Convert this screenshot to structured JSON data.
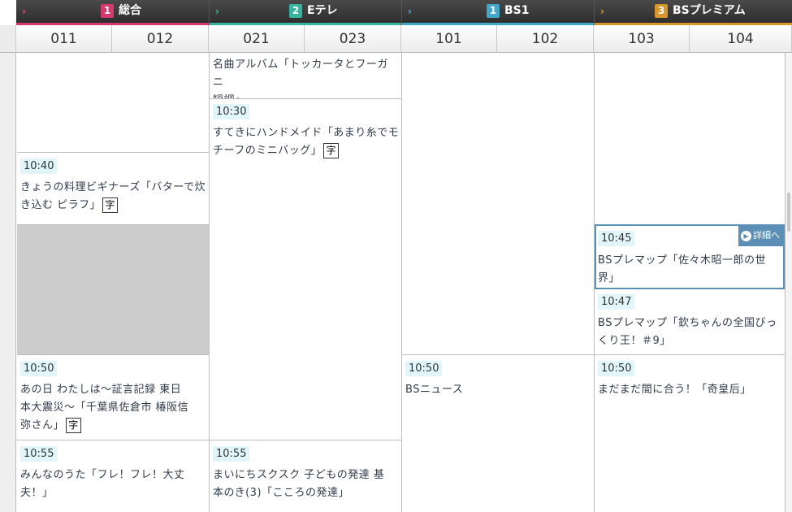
{
  "channels": [
    {
      "marker": "›",
      "marker_color": "#e84a8a",
      "num": "1",
      "num_color": "#d6386f",
      "name": "総合",
      "bar_color": "#d6386f"
    },
    {
      "marker": "›",
      "marker_color": "#3ec2a8",
      "num": "2",
      "num_color": "#35b59e",
      "name": "Eテレ",
      "bar_color": "#35b59e"
    },
    {
      "marker": "›",
      "marker_color": "#4ab4d4",
      "num": "1",
      "num_color": "#40a9c9",
      "name": "BS1",
      "bar_color": "#40a9c9"
    },
    {
      "marker": "›",
      "marker_color": "#e1a22a",
      "num": "3",
      "num_color": "#d9962a",
      "name": "BSプレミアム",
      "bar_color": "#d9962a"
    }
  ],
  "subchannels": [
    "011",
    "012",
    "021",
    "023",
    "101",
    "102",
    "103",
    "104"
  ],
  "programs": {
    "sogo_1": {
      "time": "10:40",
      "title": "きょうの料理ビギナーズ「バターで炊き込む ピラフ」",
      "title_l1": "きょうの料理ビギナーズ「バターで炊",
      "title_l2": "き込む ピラフ」",
      "badge": "字"
    },
    "sogo_2": {
      "time": "10:50",
      "title_l1": "あの日 わたしは〜証言記録 東日",
      "title_l2": "本大震災〜「千葉県佐倉市 椿阪信",
      "title_l3": "弥さん」",
      "badge": "字"
    },
    "sogo_3": {
      "time": "10:55",
      "title_l1": "みんなのうた「フレ！フレ！大丈",
      "title_l2": "夫！」"
    },
    "etv_0": {
      "title_l1": "名曲アルバム「トッカータとフーガ ニ",
      "title_l2": "短調」"
    },
    "etv_1": {
      "time": "10:30",
      "title_l1": "すてきにハンドメイド「あまり糸でモ",
      "title_l2": "チーフのミニバッグ」",
      "badge": "字"
    },
    "etv_2": {
      "time": "10:55",
      "title_l1": "まいにちスクスク 子どもの発達 基",
      "title_l2": "本のき(3)「こころの発達」"
    },
    "bs1_1": {
      "time": "10:50",
      "title_l1": "BSニュース"
    },
    "bsp_1": {
      "time": "10:45",
      "title_l1": "BSプレマップ「佐々木昭一郎の世",
      "title_l2": "界」",
      "detail": "詳細へ"
    },
    "bsp_2": {
      "time": "10:47",
      "title_l1": "BSプレマップ「欽ちゃんの全国びっ",
      "title_l2": "くり王！＃9」"
    },
    "bsp_3": {
      "time": "10:50",
      "title_l1": "まだまだ間に合う！「奇皇后」"
    }
  },
  "colors": {
    "time_bg": "#e0f6fb",
    "gap": "#cccccc",
    "selected_border": "#5c8fb6"
  }
}
